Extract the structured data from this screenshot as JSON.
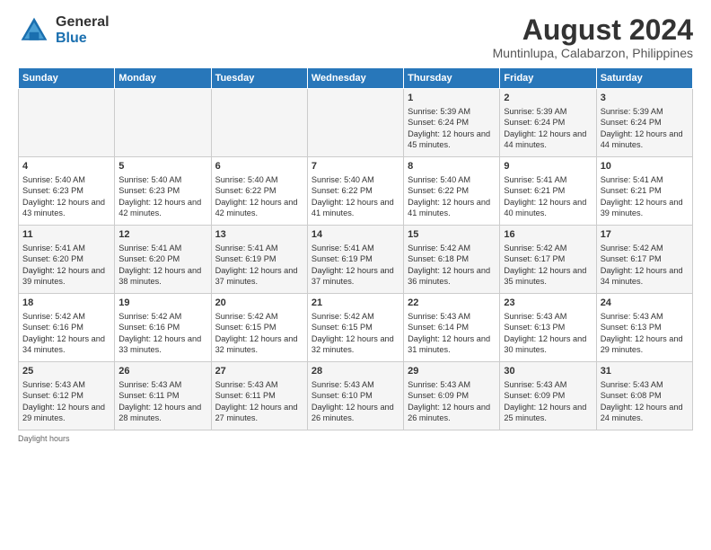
{
  "logo": {
    "general": "General",
    "blue": "Blue"
  },
  "title": "August 2024",
  "subtitle": "Muntinlupa, Calabarzon, Philippines",
  "days_header": [
    "Sunday",
    "Monday",
    "Tuesday",
    "Wednesday",
    "Thursday",
    "Friday",
    "Saturday"
  ],
  "footer": "Daylight hours",
  "weeks": [
    [
      {
        "num": "",
        "content": ""
      },
      {
        "num": "",
        "content": ""
      },
      {
        "num": "",
        "content": ""
      },
      {
        "num": "",
        "content": ""
      },
      {
        "num": "1",
        "content": "Sunrise: 5:39 AM\nSunset: 6:24 PM\nDaylight: 12 hours and 45 minutes."
      },
      {
        "num": "2",
        "content": "Sunrise: 5:39 AM\nSunset: 6:24 PM\nDaylight: 12 hours and 44 minutes."
      },
      {
        "num": "3",
        "content": "Sunrise: 5:39 AM\nSunset: 6:24 PM\nDaylight: 12 hours and 44 minutes."
      }
    ],
    [
      {
        "num": "4",
        "content": "Sunrise: 5:40 AM\nSunset: 6:23 PM\nDaylight: 12 hours and 43 minutes."
      },
      {
        "num": "5",
        "content": "Sunrise: 5:40 AM\nSunset: 6:23 PM\nDaylight: 12 hours and 42 minutes."
      },
      {
        "num": "6",
        "content": "Sunrise: 5:40 AM\nSunset: 6:22 PM\nDaylight: 12 hours and 42 minutes."
      },
      {
        "num": "7",
        "content": "Sunrise: 5:40 AM\nSunset: 6:22 PM\nDaylight: 12 hours and 41 minutes."
      },
      {
        "num": "8",
        "content": "Sunrise: 5:40 AM\nSunset: 6:22 PM\nDaylight: 12 hours and 41 minutes."
      },
      {
        "num": "9",
        "content": "Sunrise: 5:41 AM\nSunset: 6:21 PM\nDaylight: 12 hours and 40 minutes."
      },
      {
        "num": "10",
        "content": "Sunrise: 5:41 AM\nSunset: 6:21 PM\nDaylight: 12 hours and 39 minutes."
      }
    ],
    [
      {
        "num": "11",
        "content": "Sunrise: 5:41 AM\nSunset: 6:20 PM\nDaylight: 12 hours and 39 minutes."
      },
      {
        "num": "12",
        "content": "Sunrise: 5:41 AM\nSunset: 6:20 PM\nDaylight: 12 hours and 38 minutes."
      },
      {
        "num": "13",
        "content": "Sunrise: 5:41 AM\nSunset: 6:19 PM\nDaylight: 12 hours and 37 minutes."
      },
      {
        "num": "14",
        "content": "Sunrise: 5:41 AM\nSunset: 6:19 PM\nDaylight: 12 hours and 37 minutes."
      },
      {
        "num": "15",
        "content": "Sunrise: 5:42 AM\nSunset: 6:18 PM\nDaylight: 12 hours and 36 minutes."
      },
      {
        "num": "16",
        "content": "Sunrise: 5:42 AM\nSunset: 6:17 PM\nDaylight: 12 hours and 35 minutes."
      },
      {
        "num": "17",
        "content": "Sunrise: 5:42 AM\nSunset: 6:17 PM\nDaylight: 12 hours and 34 minutes."
      }
    ],
    [
      {
        "num": "18",
        "content": "Sunrise: 5:42 AM\nSunset: 6:16 PM\nDaylight: 12 hours and 34 minutes."
      },
      {
        "num": "19",
        "content": "Sunrise: 5:42 AM\nSunset: 6:16 PM\nDaylight: 12 hours and 33 minutes."
      },
      {
        "num": "20",
        "content": "Sunrise: 5:42 AM\nSunset: 6:15 PM\nDaylight: 12 hours and 32 minutes."
      },
      {
        "num": "21",
        "content": "Sunrise: 5:42 AM\nSunset: 6:15 PM\nDaylight: 12 hours and 32 minutes."
      },
      {
        "num": "22",
        "content": "Sunrise: 5:43 AM\nSunset: 6:14 PM\nDaylight: 12 hours and 31 minutes."
      },
      {
        "num": "23",
        "content": "Sunrise: 5:43 AM\nSunset: 6:13 PM\nDaylight: 12 hours and 30 minutes."
      },
      {
        "num": "24",
        "content": "Sunrise: 5:43 AM\nSunset: 6:13 PM\nDaylight: 12 hours and 29 minutes."
      }
    ],
    [
      {
        "num": "25",
        "content": "Sunrise: 5:43 AM\nSunset: 6:12 PM\nDaylight: 12 hours and 29 minutes."
      },
      {
        "num": "26",
        "content": "Sunrise: 5:43 AM\nSunset: 6:11 PM\nDaylight: 12 hours and 28 minutes."
      },
      {
        "num": "27",
        "content": "Sunrise: 5:43 AM\nSunset: 6:11 PM\nDaylight: 12 hours and 27 minutes."
      },
      {
        "num": "28",
        "content": "Sunrise: 5:43 AM\nSunset: 6:10 PM\nDaylight: 12 hours and 26 minutes."
      },
      {
        "num": "29",
        "content": "Sunrise: 5:43 AM\nSunset: 6:09 PM\nDaylight: 12 hours and 26 minutes."
      },
      {
        "num": "30",
        "content": "Sunrise: 5:43 AM\nSunset: 6:09 PM\nDaylight: 12 hours and 25 minutes."
      },
      {
        "num": "31",
        "content": "Sunrise: 5:43 AM\nSunset: 6:08 PM\nDaylight: 12 hours and 24 minutes."
      }
    ]
  ]
}
